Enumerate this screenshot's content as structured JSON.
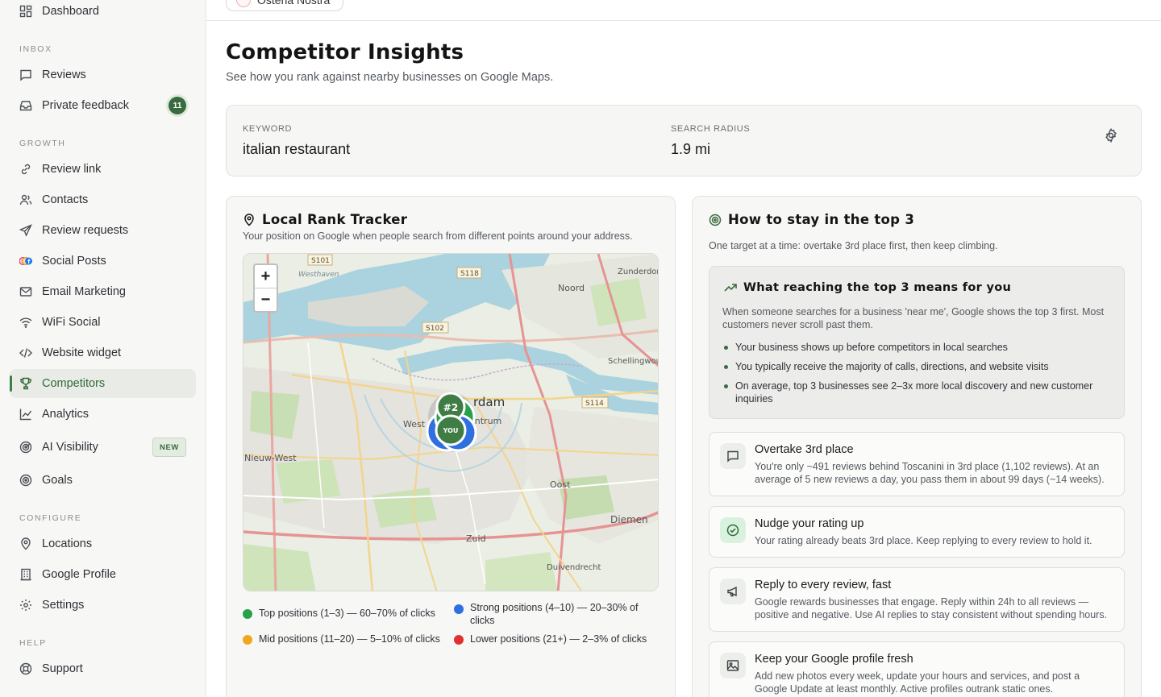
{
  "sidebar": {
    "dashboard": "Dashboard",
    "sections": {
      "inbox": "INBOX",
      "growth": "GROWTH",
      "configure": "CONFIGURE",
      "help": "HELP"
    },
    "inbox_items": [
      {
        "label": "Reviews",
        "icon": "message-icon"
      },
      {
        "label": "Private feedback",
        "icon": "inbox-icon",
        "badge": "11"
      }
    ],
    "growth_items": [
      {
        "label": "Review link",
        "icon": "link-icon"
      },
      {
        "label": "Contacts",
        "icon": "users-icon"
      },
      {
        "label": "Review requests",
        "icon": "send-icon"
      },
      {
        "label": "Social Posts",
        "icon": "social-icon"
      },
      {
        "label": "Email Marketing",
        "icon": "mail-icon"
      },
      {
        "label": "WiFi Social",
        "icon": "wifi-icon"
      },
      {
        "label": "Website widget",
        "icon": "code-icon"
      },
      {
        "label": "Competitors",
        "icon": "trophy-icon",
        "active": true
      },
      {
        "label": "Analytics",
        "icon": "chart-icon"
      },
      {
        "label": "AI Visibility",
        "icon": "radar-icon",
        "badge": "NEW"
      },
      {
        "label": "Goals",
        "icon": "target-icon"
      }
    ],
    "configure_items": [
      {
        "label": "Locations",
        "icon": "pin-icon"
      },
      {
        "label": "Google Profile",
        "icon": "building-icon"
      },
      {
        "label": "Settings",
        "icon": "gear-icon"
      }
    ],
    "help_items": [
      {
        "label": "Support",
        "icon": "lifebuoy-icon"
      }
    ]
  },
  "topbar": {
    "location": "Osteria Nostra"
  },
  "page": {
    "title": "Competitor Insights",
    "subtitle": "See how you rank against nearby businesses on Google Maps."
  },
  "search": {
    "keyword_label": "KEYWORD",
    "keyword_value": "italian restaurant",
    "radius_label": "SEARCH RADIUS",
    "radius_value": "1.9 mi"
  },
  "tracker": {
    "title": "Local Rank Tracker",
    "subtitle": "Your position on Google when people search from different points around your address.",
    "map": {
      "zoom_in": "+",
      "zoom_out": "−",
      "rank_marker": "#2",
      "you_marker": "YOU",
      "labels": [
        "S101",
        "Westhaven",
        "S118",
        "Zunderdor",
        "Noord",
        "S102",
        "Schellingwou",
        "rdam",
        "S114",
        "West",
        "entrum",
        "Nieuw-West",
        "Oost",
        "Diemen",
        "Zuid",
        "Duivendrecht"
      ]
    },
    "legend": [
      {
        "label": "Top positions (1–3) — 60–70% of clicks",
        "color": "#27a14a"
      },
      {
        "label": "Strong positions (4–10) — 20–30% of clicks",
        "color": "#2f6fe0"
      },
      {
        "label": "Mid positions (11–20) — 5–10% of clicks",
        "color": "#f2a61f"
      },
      {
        "label": "Lower positions (21+) — 2–3% of clicks",
        "color": "#e03131"
      }
    ]
  },
  "top3": {
    "title": "How to stay in the top 3",
    "subtitle": "One target at a time: overtake 3rd place first, then keep climbing.",
    "info_title": "What reaching the top 3 means for you",
    "info_desc": "When someone searches for a business 'near me', Google shows the top 3 first. Most customers never scroll past them.",
    "bullets": [
      "Your business shows up before competitors in local searches",
      "You typically receive the majority of calls, directions, and website visits",
      "On average, top 3 businesses see 2–3x more local discovery and new customer inquiries"
    ],
    "tips": [
      {
        "title": "Overtake 3rd place",
        "desc": "You're only ~491 reviews behind Toscanini in 3rd place (1,102 reviews). At an average of 5 new reviews a day, you pass them in about 99 days (~14 weeks).",
        "icon": "message-square-icon"
      },
      {
        "title": "Nudge your rating up",
        "desc": "Your rating already beats 3rd place. Keep replying to every review to hold it.",
        "icon": "check-circle-icon"
      },
      {
        "title": "Reply to every review, fast",
        "desc": "Google rewards businesses that engage. Reply within 24h to all reviews — positive and negative. Use AI replies to stay consistent without spending hours.",
        "icon": "megaphone-icon"
      },
      {
        "title": "Keep your Google profile fresh",
        "desc": "Add new photos every week, update your hours and services, and post a Google Update at least monthly. Active profiles outrank static ones.",
        "icon": "image-icon"
      }
    ]
  },
  "colors": {
    "accent": "#3a6b3f",
    "top": "#27a14a",
    "strong": "#2f6fe0",
    "mid": "#f2a61f",
    "low": "#e03131"
  }
}
